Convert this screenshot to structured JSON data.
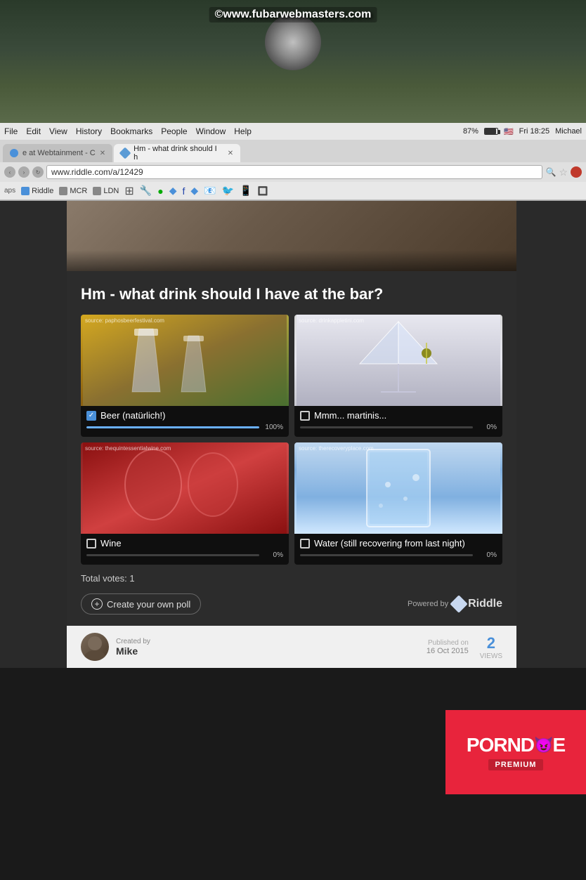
{
  "watermark": {
    "text": "©www.fubarwebmasters.com"
  },
  "browser": {
    "menu": {
      "items": [
        "File",
        "Edit",
        "View",
        "History",
        "Bookmarks",
        "People",
        "Window",
        "Help"
      ]
    },
    "status": {
      "volume": "87%",
      "time": "Fri 18:25",
      "user": "Michael"
    },
    "tabs": [
      {
        "label": "e at Webtainment - C",
        "active": false,
        "favicon": "circle"
      },
      {
        "label": "Hm - what drink should I h",
        "active": true,
        "favicon": "diamond"
      }
    ],
    "address": "www.riddle.com/a/12429",
    "bookmarks": [
      {
        "label": "Riddle",
        "color": "#4a90d9"
      },
      {
        "label": "MCR",
        "color": "#888"
      },
      {
        "label": "LDN",
        "color": "#888"
      }
    ]
  },
  "poll": {
    "title": "Hm - what drink should I have at the bar?",
    "options": [
      {
        "id": "beer",
        "label": "Beer (natürlich!)",
        "checked": true,
        "percent": 100,
        "percent_label": "100%",
        "source": "source: paphosbeerfestival.com",
        "image_class": "img-beer"
      },
      {
        "id": "martini",
        "label": "Mmm... martinis...",
        "checked": false,
        "percent": 0,
        "percent_label": "0%",
        "source": "source: drinkappletini.com",
        "image_class": "img-martini"
      },
      {
        "id": "wine",
        "label": "Wine",
        "checked": false,
        "percent": 0,
        "percent_label": "0%",
        "source": "source: thequintessentialwine.com",
        "image_class": "img-wine"
      },
      {
        "id": "water",
        "label": "Water (still recovering from last night)",
        "checked": false,
        "percent": 0,
        "percent_label": "0%",
        "source": "source: therecoveryplace.com",
        "image_class": "img-water"
      }
    ],
    "total_votes_label": "Total votes: 1",
    "create_poll_label": "Create your own poll",
    "powered_by_label": "Powered by",
    "riddle_label": "Riddle"
  },
  "author": {
    "created_by_label": "Created by",
    "name": "Mike",
    "published_label": "Published on",
    "published_date": "16 Oct 2015",
    "views": "2",
    "views_label": "VIEWS"
  },
  "branding": {
    "name": "PORNDOE",
    "premium": "PREMIUM"
  }
}
